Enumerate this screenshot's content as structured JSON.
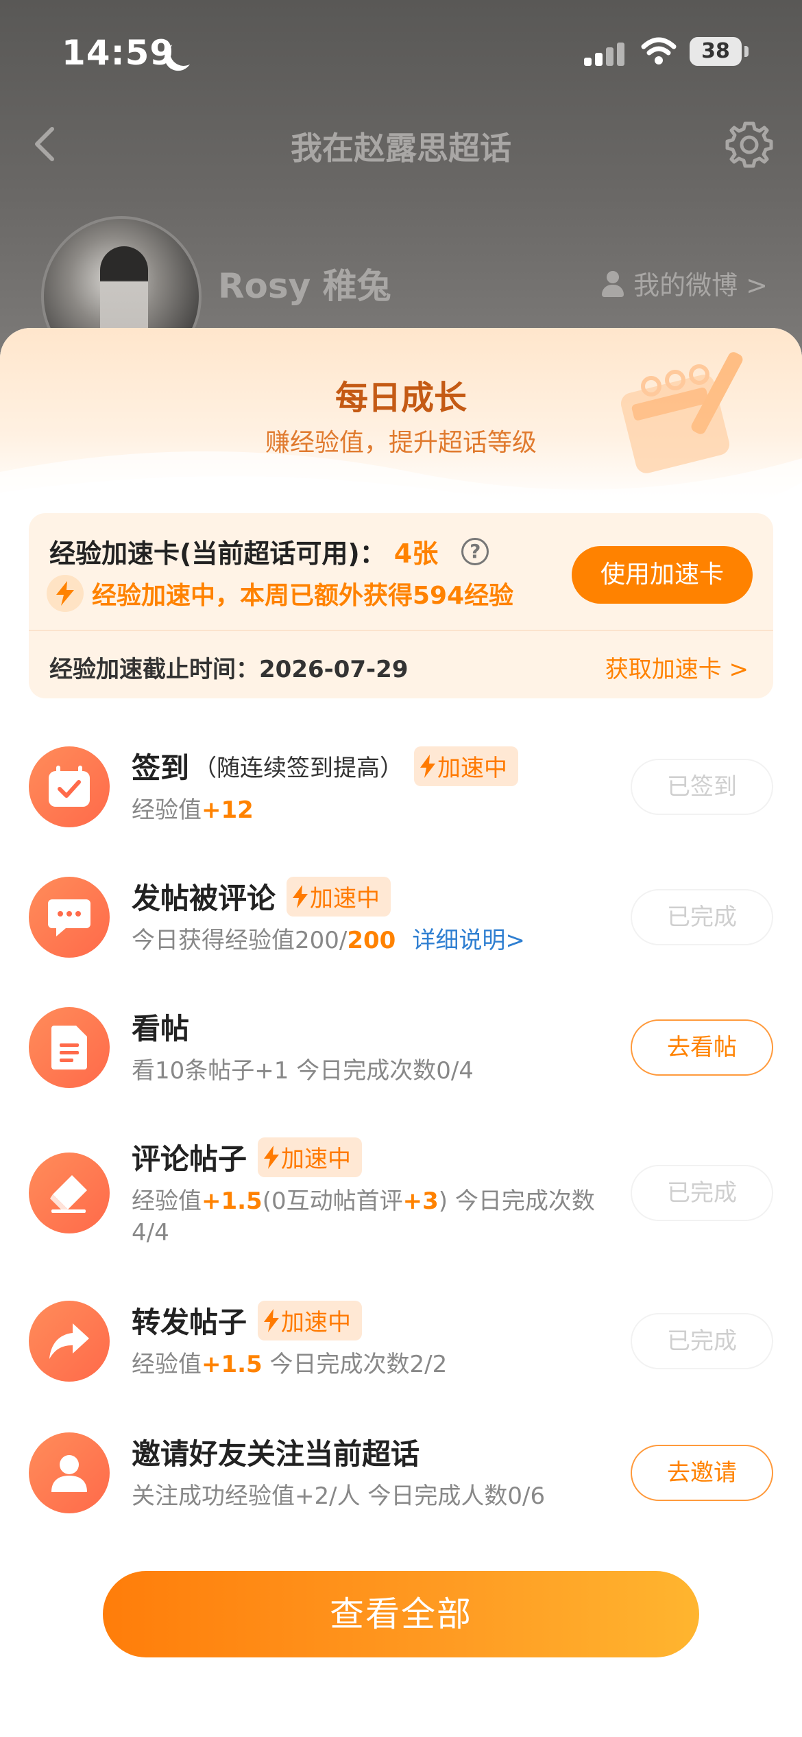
{
  "status_bar": {
    "time": "14:59",
    "battery": "38"
  },
  "navbar": {
    "title": "我在赵露思超话"
  },
  "profile": {
    "username": "Rosy 稚兔",
    "weibo_link": "我的微博 >"
  },
  "daily_growth": {
    "title": "每日成长",
    "subtitle": "赚经验值，提升超话等级"
  },
  "boost_card": {
    "label": "经验加速卡(当前超话可用)：",
    "count": "4张",
    "status": "经验加速中，本周已额外获得594经验",
    "use_button": "使用加速卡",
    "deadline": "经验加速截止时间：2026-07-29",
    "get_card": "获取加速卡 >"
  },
  "badge_label": "加速中",
  "tasks": [
    {
      "title": "签到",
      "hint": "（随连续签到提高）",
      "desc_prefix": "经验值",
      "desc_hl": "+12",
      "button": "已签到"
    },
    {
      "title": "发帖被评论",
      "desc_prefix": "今日获得经验值200/",
      "desc_hl": "200",
      "link": "详细说明>",
      "button": "已完成"
    },
    {
      "title": "看帖",
      "desc": "看10条帖子+1   今日完成次数0/4",
      "button": "去看帖"
    },
    {
      "title": "评论帖子",
      "desc_a": "经验值",
      "desc_b": "+1.5",
      "desc_c": "(0互动帖首评",
      "desc_d": "+3",
      "desc_e": ")   今日完成次数",
      "desc_f": "4/4",
      "button": "已完成"
    },
    {
      "title": "转发帖子",
      "desc_prefix": "经验值",
      "desc_hl": "+1.5",
      "desc_suffix": "   今日完成次数2/2",
      "button": "已完成"
    },
    {
      "title": "邀请好友关注当前超话",
      "desc": "关注成功经验值+2/人   今日完成人数0/6",
      "button": "去邀请"
    }
  ],
  "view_all": "查看全部",
  "colors": {
    "accent": "#ff8200",
    "icon_gradient": "#ff6a4a",
    "link": "#2f7fd1"
  }
}
